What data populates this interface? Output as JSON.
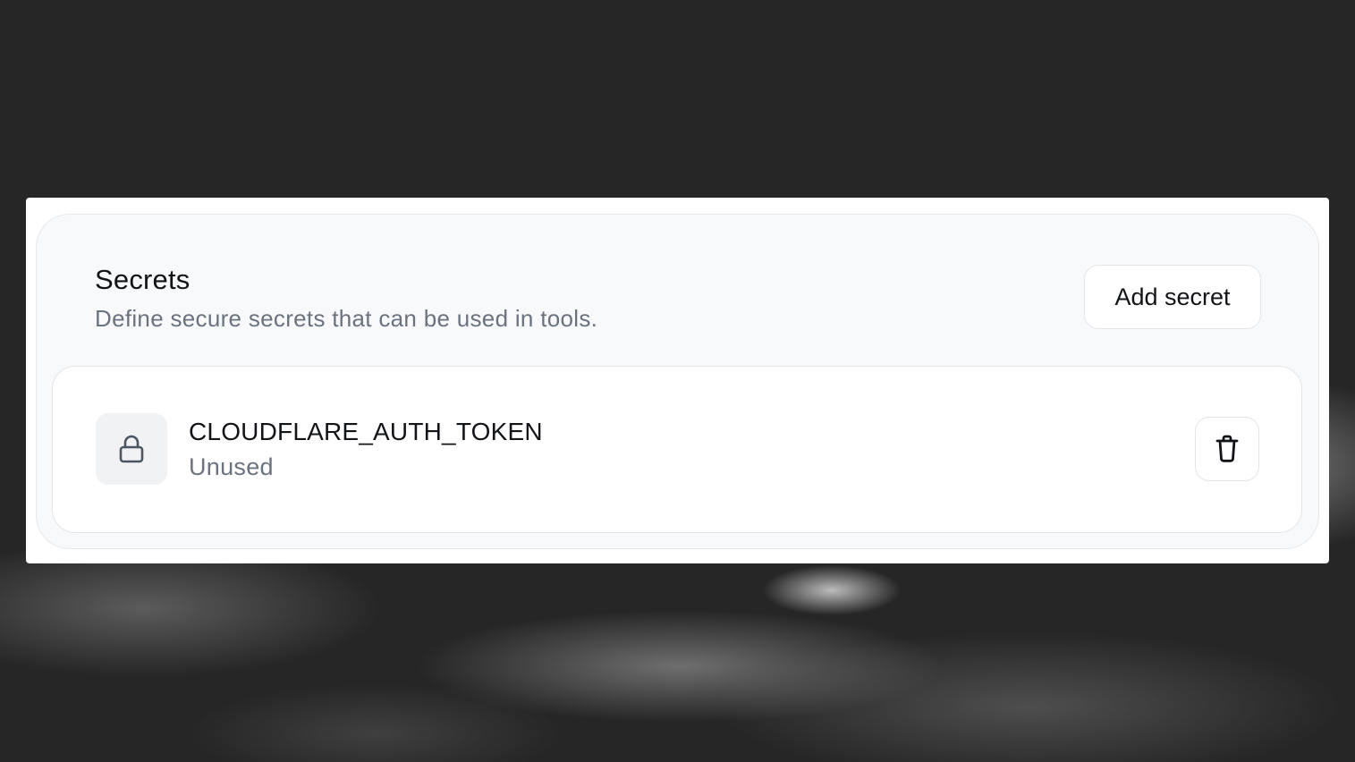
{
  "secrets_panel": {
    "title": "Secrets",
    "description": "Define secure secrets that can be used in tools.",
    "add_button_label": "Add secret",
    "items": [
      {
        "icon": "lock-icon",
        "name": "CLOUDFLARE_AUTH_TOKEN",
        "status": "Unused",
        "action_icon": "trash-icon"
      }
    ]
  }
}
